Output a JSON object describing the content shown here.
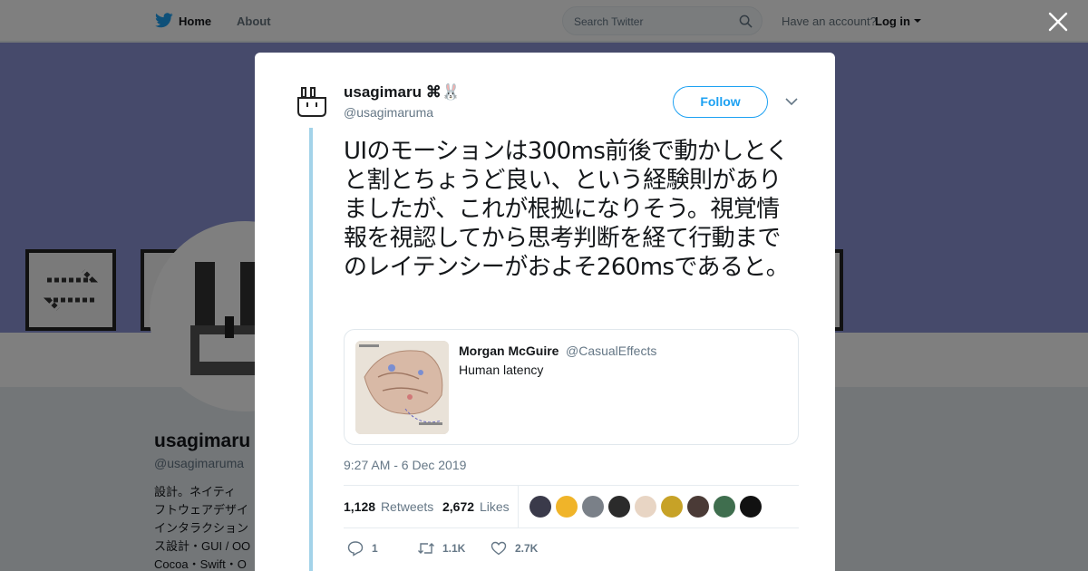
{
  "topnav": {
    "home_label": "Home",
    "about_label": "About",
    "search_placeholder": "Search Twitter",
    "account_prompt": "Have an account?",
    "login_label": "Log in"
  },
  "colors": {
    "brand": "#1da1f2",
    "thread_line": "#a3d3e9",
    "banner": "#8c95d6"
  },
  "profile": {
    "name": "usagimaru",
    "handle": "@usagimaruma",
    "bio": "設計。ネイティ\nフトウェアデザイ\nインタラクション\nス設計・GUI / OO\nCocoa・Swift・O"
  },
  "tweet": {
    "author_name": "usagimaru ⌘🐰",
    "author_handle": "@usagimaruma",
    "follow_label": "Follow",
    "text": "UIのモーションは300ms前後で動かしとくと割とちょうど良い、という経験則がありましたが、これが根拠になりそう。視覚情報を視認してから思考判断を経て行動までのレイテンシーがおよそ260msであると。",
    "quote": {
      "name": "Morgan McGuire",
      "handle": "@CasualEffects",
      "text": "Human latency"
    },
    "timestamp": "9:27 AM - 6 Dec 2019",
    "retweets_count": "1,128",
    "retweets_label": "Retweets",
    "likes_count": "2,672",
    "likes_label": "Likes",
    "liker_colors": [
      "#3a3a4a",
      "#f0b429",
      "#7a8088",
      "#2b2b2b",
      "#e8d5c4",
      "#c7a227",
      "#4a3a36",
      "#3f6e4e",
      "#111111"
    ],
    "actions": {
      "reply_count": "1",
      "retweet_count": "1.1K",
      "like_count": "2.7K"
    }
  }
}
